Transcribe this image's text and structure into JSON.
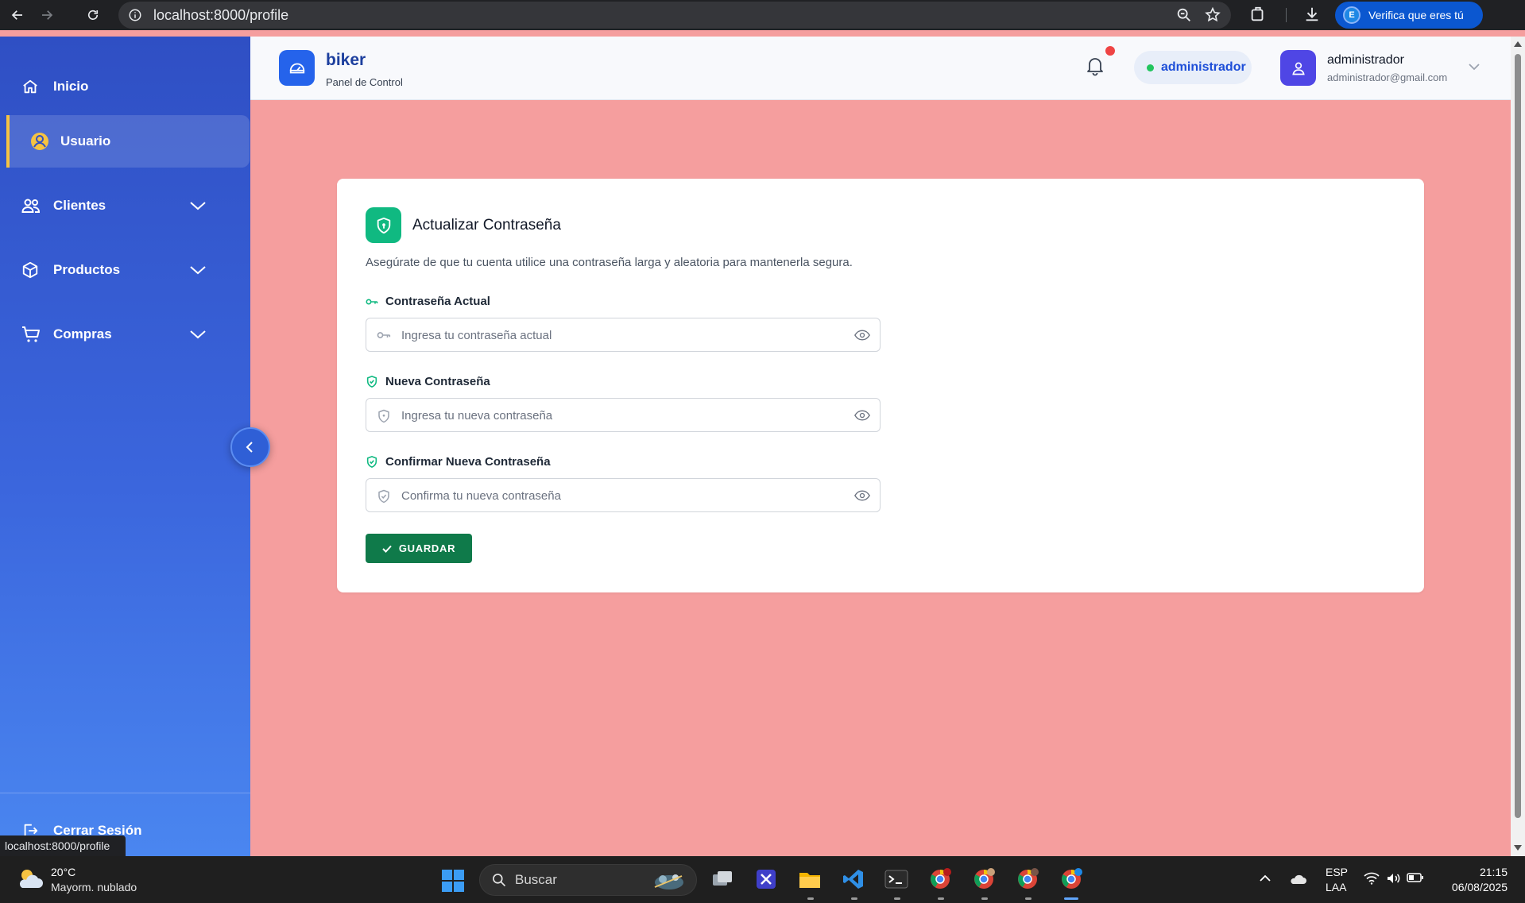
{
  "browser": {
    "url": "localhost:8000/profile",
    "profile_button_label": "Verifica que eres tú",
    "profile_badge": "E"
  },
  "sidebar": {
    "items": [
      {
        "label": "Inicio",
        "icon": "home-icon"
      },
      {
        "label": "Usuario",
        "icon": "user-circle-icon",
        "active": true
      },
      {
        "label": "Clientes",
        "icon": "users-icon",
        "expandable": true
      },
      {
        "label": "Productos",
        "icon": "box-icon",
        "expandable": true
      },
      {
        "label": "Compras",
        "icon": "cart-icon",
        "expandable": true
      }
    ],
    "logout_label": "Cerrar Sesión",
    "active_accent": "#f6c342"
  },
  "status_bar": {
    "url": "localhost:8000/profile"
  },
  "header": {
    "brand": "biker",
    "subtitle": "Panel de Control",
    "role_badge": "administrador",
    "user": {
      "name": "administrador",
      "email": "administrador@gmail.com"
    },
    "notification_dot_color": "#ef4444"
  },
  "card": {
    "title": "Actualizar Contraseña",
    "description": "Asegúrate de que tu cuenta utilice una contraseña larga y aleatoria para mantenerla segura.",
    "fields": [
      {
        "label": "Contraseña Actual",
        "placeholder": "Ingresa tu contraseña actual",
        "value": "",
        "icon": "key-icon"
      },
      {
        "label": "Nueva Contraseña",
        "placeholder": "Ingresa tu nueva contraseña",
        "value": "",
        "icon": "shield-icon"
      },
      {
        "label": "Confirmar Nueva Contraseña",
        "placeholder": "Confirma tu nueva contraseña",
        "value": "",
        "icon": "shield-icon"
      }
    ],
    "save_label": "GUARDAR",
    "accent": "#10b981",
    "button_color": "#0f7a4a"
  },
  "page": {
    "background": "#f59e9e"
  },
  "taskbar": {
    "weather": {
      "temp": "20°C",
      "desc": "Mayorm. nublado"
    },
    "search_label": "Buscar",
    "lang": {
      "line1": "ESP",
      "line2": "LAA"
    },
    "time": "21:15",
    "date": "06/08/2025",
    "apps": [
      "task-view",
      "snipping-tool",
      "file-explorer",
      "vscode",
      "terminal",
      "chrome-profile-r",
      "chrome-profile-avatar",
      "chrome-profile-k",
      "chrome-profile-e"
    ]
  }
}
